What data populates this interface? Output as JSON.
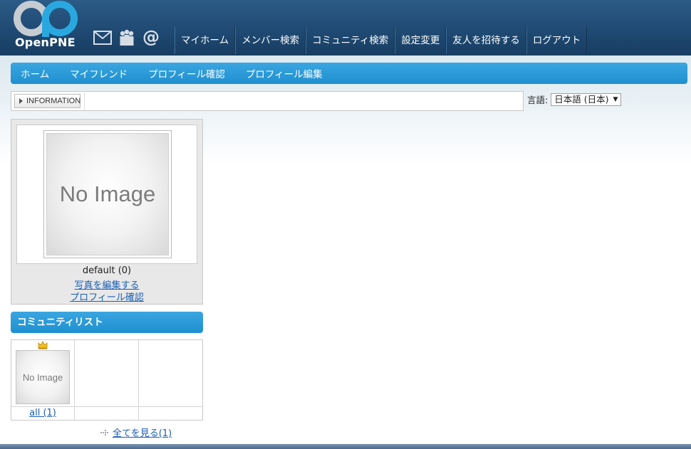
{
  "header": {
    "logo_text": "OpenPNE",
    "icons": [
      "mail-icon",
      "members-icon",
      "at-icon"
    ],
    "global_nav": [
      "マイホーム",
      "メンバー検索",
      "コミュニティ検索",
      "設定変更",
      "友人を招待する",
      "ログアウト"
    ]
  },
  "local_nav": [
    "ホーム",
    "マイフレンド",
    "プロフィール確認",
    "プロフィール編集"
  ],
  "information": {
    "label": "INFORMATION",
    "text": ""
  },
  "language": {
    "label": "言語:",
    "selected": "日本語 (日本)"
  },
  "profile": {
    "image_text": "No Image",
    "name": "default (0)",
    "edit_photo_link": "写真を編集する",
    "view_profile_link": "プロフィール確認"
  },
  "community": {
    "title": "コミュニティリスト",
    "items": [
      {
        "image_text": "No Image",
        "label": "all (1)"
      }
    ],
    "see_all": "全てを見る(1)"
  },
  "colors": {
    "header_bg": "#1f4a73",
    "nav_blue": "#2a9ad8",
    "link": "#1a5fb4",
    "logo_blue": "#29a8e0"
  }
}
